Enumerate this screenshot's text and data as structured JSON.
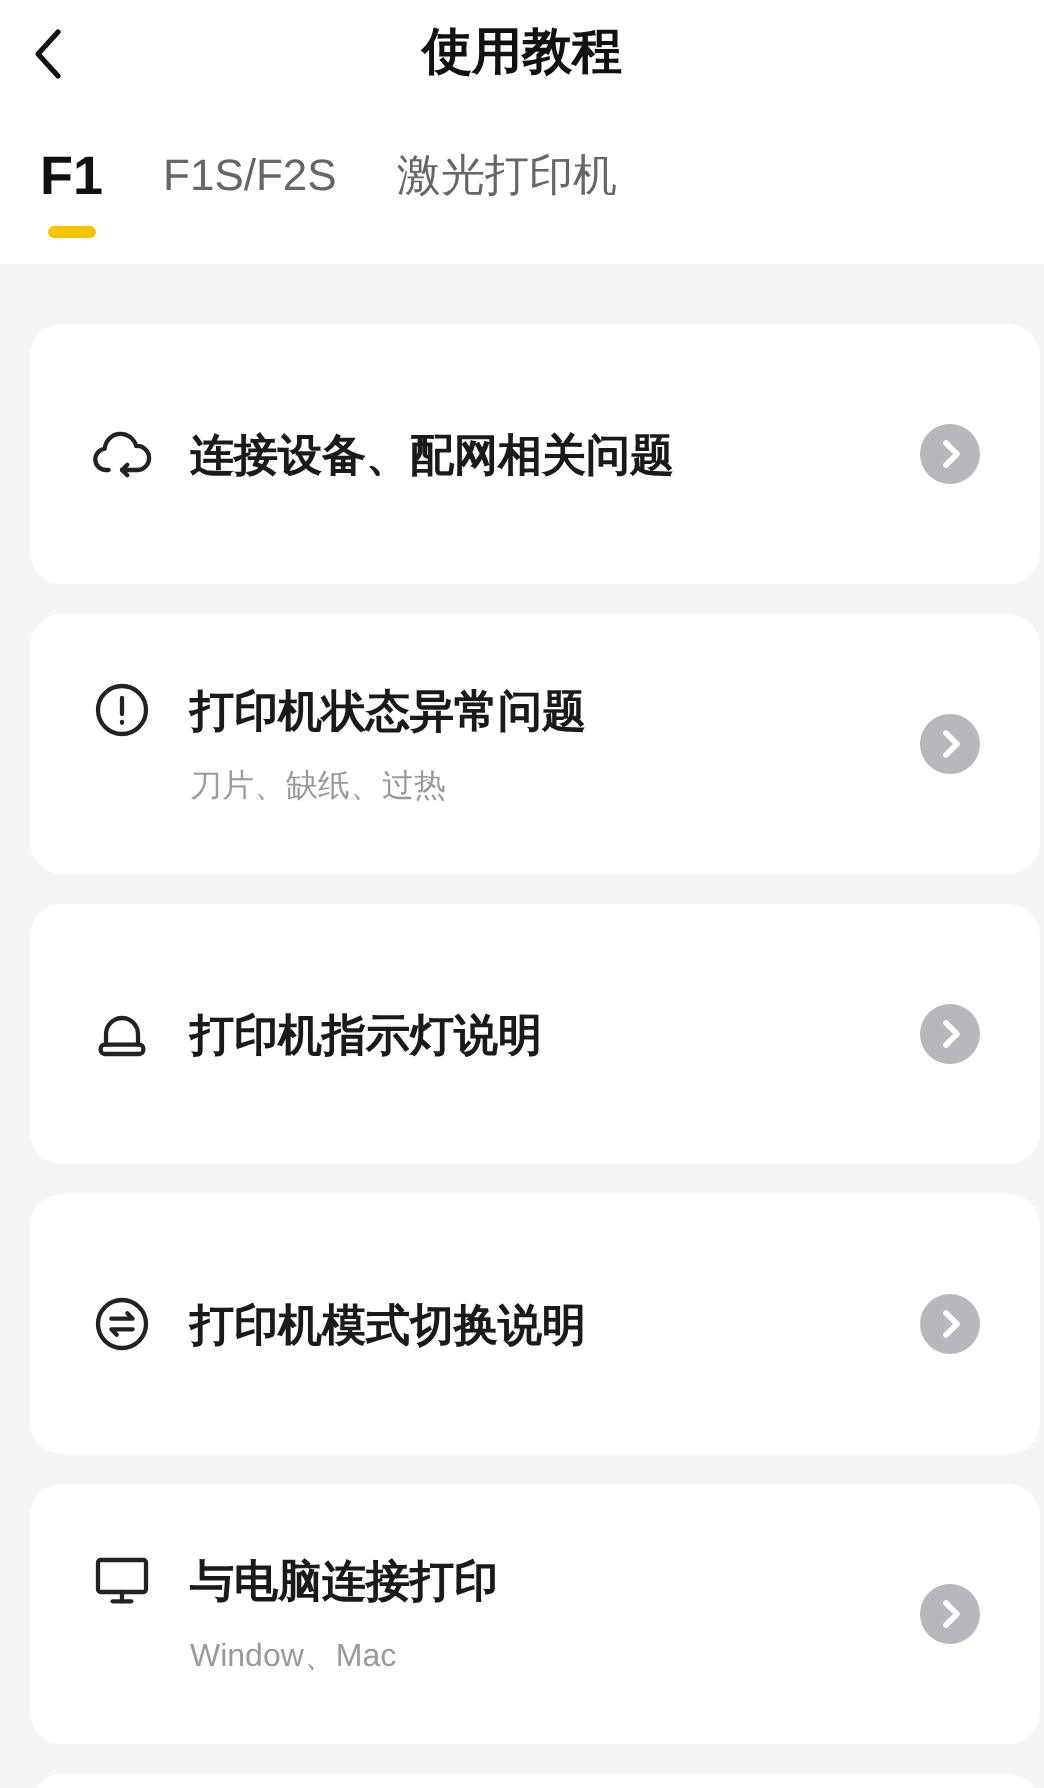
{
  "header": {
    "title": "使用教程"
  },
  "tabs": [
    {
      "label": "F1",
      "selected": true
    },
    {
      "label": "F1S/F2S",
      "selected": false
    },
    {
      "label": "激光打印机",
      "selected": false
    }
  ],
  "items": [
    {
      "kind": "cloud",
      "title": "连接设备、配网相关问题"
    },
    {
      "kind": "alert",
      "title": "打印机状态异常问题",
      "subtitle": "刀片、缺纸、过热"
    },
    {
      "kind": "lamp",
      "title": "打印机指示灯说明"
    },
    {
      "kind": "switch",
      "title": "打印机模式切换说明"
    },
    {
      "kind": "monitor",
      "title": "与电脑连接打印",
      "subtitle": "Window、Mac"
    }
  ]
}
